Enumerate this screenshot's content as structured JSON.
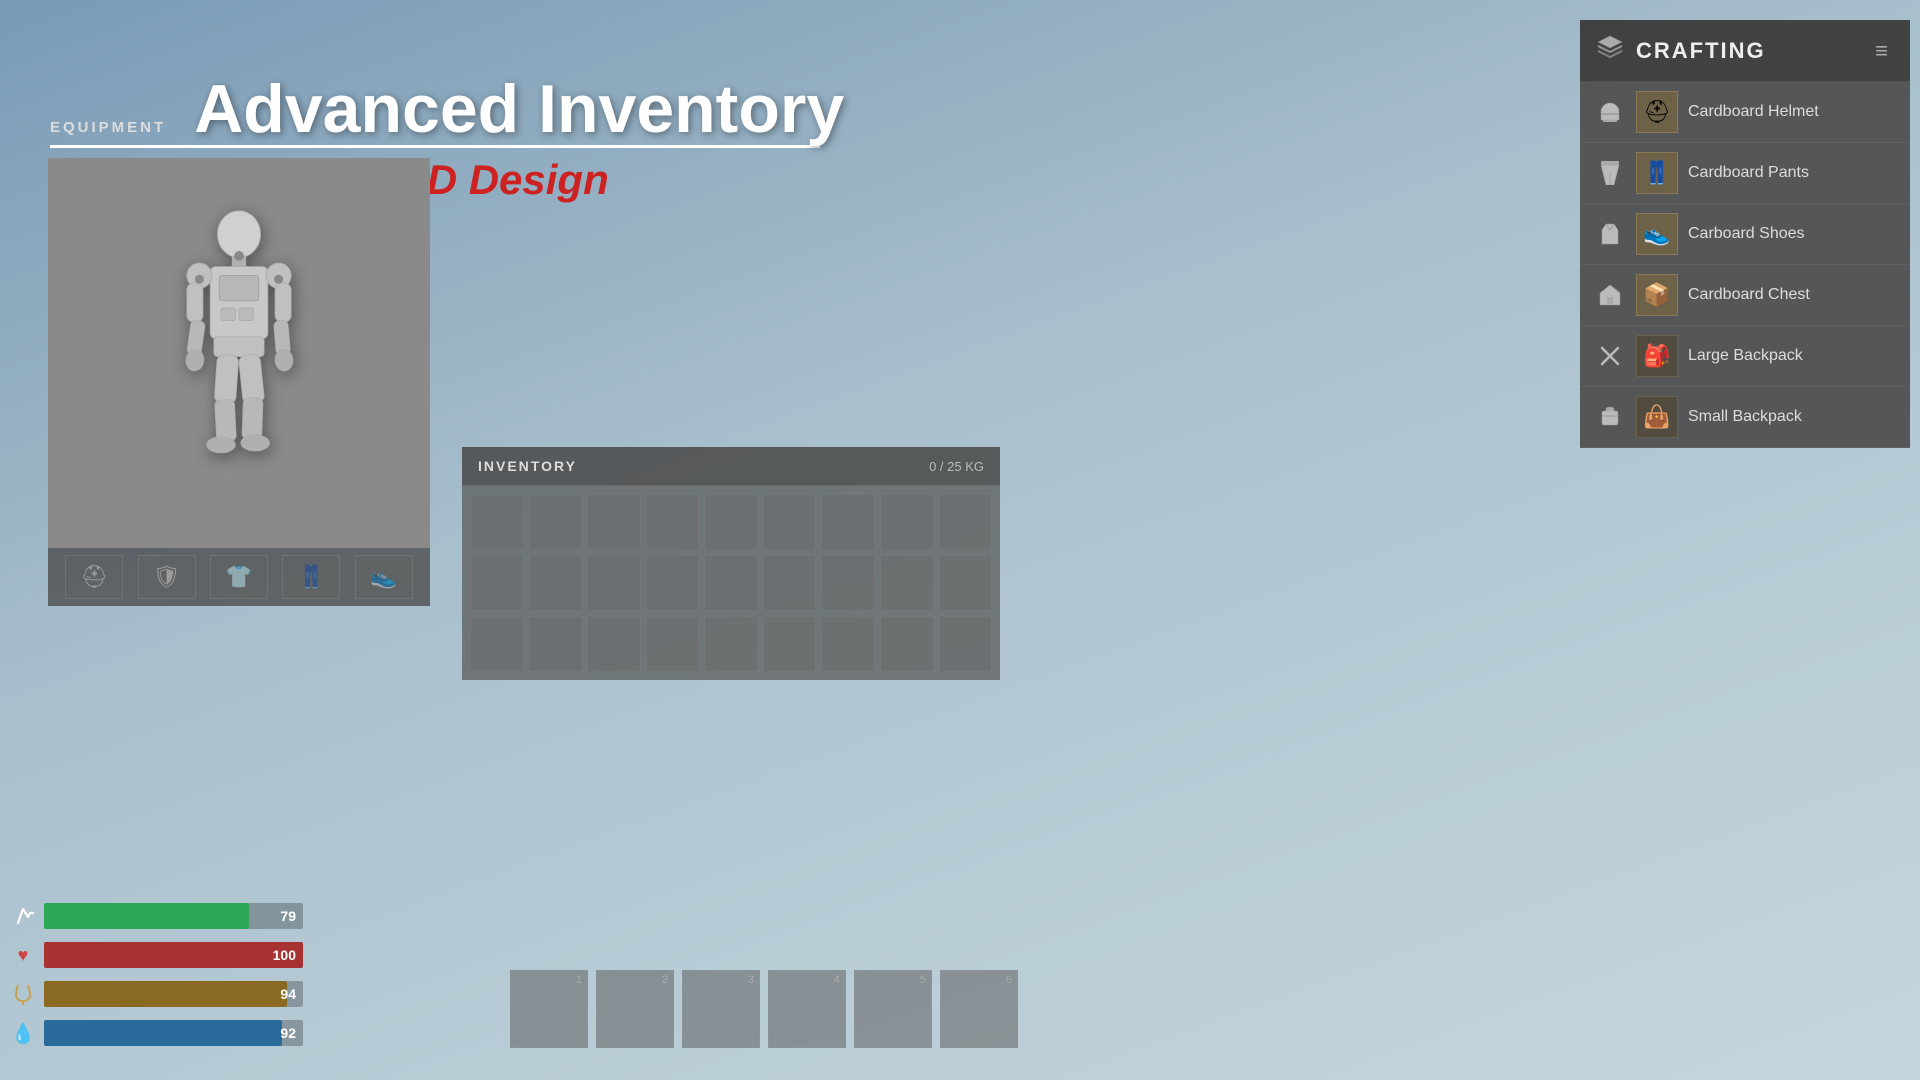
{
  "header": {
    "equipment_label": "EQUIPMENT",
    "main_title": "Advanced Inventory",
    "subtitle": "Clean HUD Design",
    "title_underline": true
  },
  "inventory": {
    "label": "INVENTORY",
    "weight_current": 0,
    "weight_max": 25,
    "weight_unit": "KG",
    "weight_display": "0 / 25 KG",
    "rows": 3,
    "cols": 9
  },
  "hotbar": {
    "slots": [
      {
        "number": "1"
      },
      {
        "number": "2"
      },
      {
        "number": "3"
      },
      {
        "number": "4"
      },
      {
        "number": "5"
      },
      {
        "number": "6"
      }
    ]
  },
  "stats": [
    {
      "id": "stamina",
      "icon": "🏃",
      "value": 79,
      "max": 100,
      "color": "#2ea857"
    },
    {
      "id": "health",
      "icon": "❤",
      "value": 100,
      "max": 100,
      "color": "#a83232"
    },
    {
      "id": "hunger",
      "icon": "🍖",
      "value": 94,
      "max": 100,
      "color": "#8a6a22"
    },
    {
      "id": "thirst",
      "icon": "💧",
      "value": 92,
      "max": 100,
      "color": "#2a6a9a"
    }
  ],
  "crafting": {
    "title": "CRAFTING",
    "items": [
      {
        "id": "cardboard-helmet",
        "name": "Cardboard Helmet",
        "icon": "⛑",
        "cat": "helmet"
      },
      {
        "id": "cardboard-pants",
        "name": "Cardboard Pants",
        "icon": "👖",
        "cat": "pants"
      },
      {
        "id": "carboard-shoes",
        "name": "Carboard Shoes",
        "icon": "👟",
        "cat": "shirt"
      },
      {
        "id": "cardboard-chest",
        "name": "Cardboard Chest",
        "icon": "🏠",
        "cat": "house"
      },
      {
        "id": "large-backpack",
        "name": "Large Backpack",
        "icon": "🎒",
        "cat": "tools"
      },
      {
        "id": "small-backpack",
        "name": "Small Backpack",
        "icon": "👜",
        "cat": "bag"
      }
    ]
  },
  "equipment_slots": [
    {
      "id": "head",
      "icon": "⛑"
    },
    {
      "id": "body",
      "icon": "🛡"
    },
    {
      "id": "shirt",
      "icon": "👕"
    },
    {
      "id": "legs",
      "icon": "👖"
    },
    {
      "id": "feet",
      "icon": "👟"
    }
  ]
}
